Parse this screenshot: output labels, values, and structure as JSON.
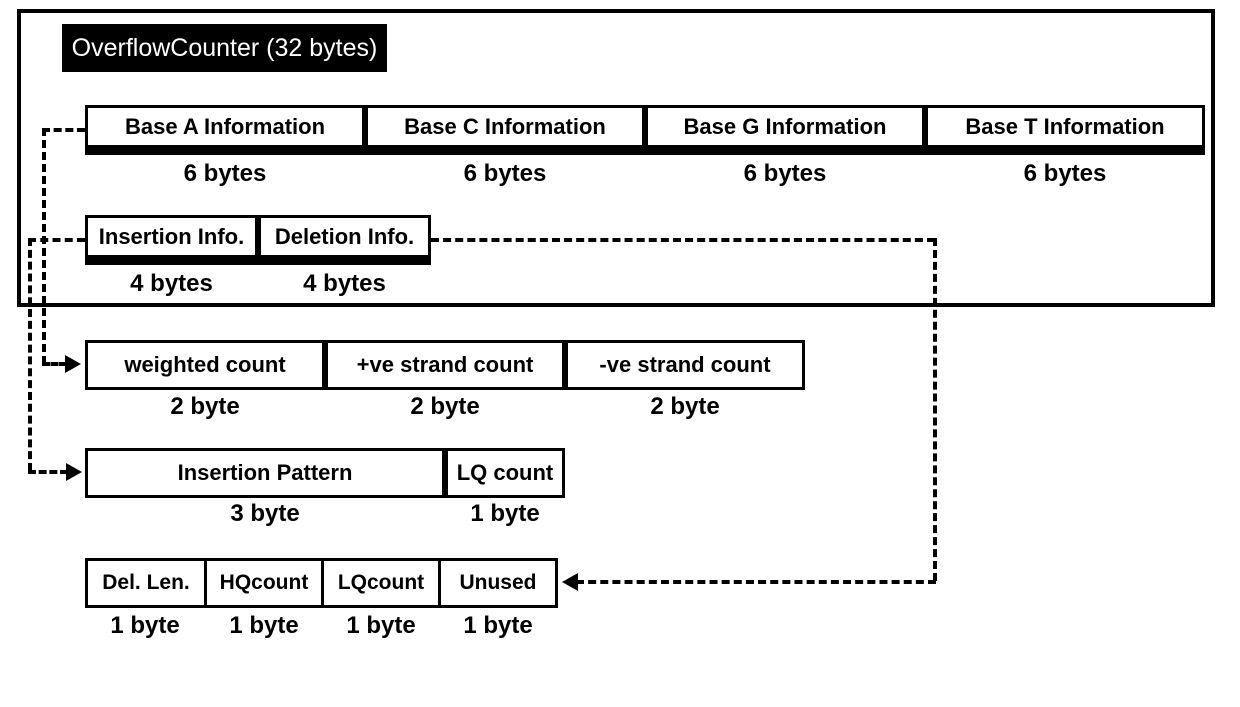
{
  "title": "OverflowCounter (32 bytes)",
  "row1": {
    "cells": [
      "Base A Information",
      "Base C Information",
      "Base G Information",
      "Base T Information"
    ],
    "sizes": [
      "6 bytes",
      "6 bytes",
      "6 bytes",
      "6 bytes"
    ]
  },
  "row2": {
    "cells": [
      "Insertion Info.",
      "Deletion Info."
    ],
    "sizes": [
      "4 bytes",
      "4 bytes"
    ]
  },
  "row3": {
    "cells": [
      "weighted count",
      "+ve strand count",
      "-ve strand count"
    ],
    "sizes": [
      "2 byte",
      "2 byte",
      "2 byte"
    ]
  },
  "row4": {
    "cells": [
      "Insertion Pattern",
      "LQ count"
    ],
    "sizes": [
      "3 byte",
      "1 byte"
    ]
  },
  "row5": {
    "cells": [
      "Del. Len.",
      "HQcount",
      "LQcount",
      "Unused"
    ],
    "sizes": [
      "1 byte",
      "1 byte",
      "1 byte",
      "1 byte"
    ]
  }
}
